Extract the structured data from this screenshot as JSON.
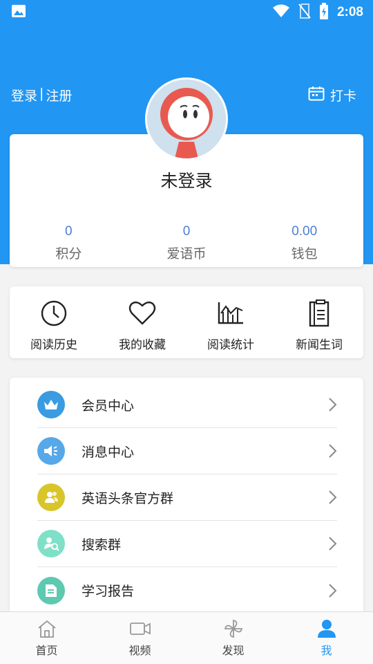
{
  "status_bar": {
    "time": "2:08"
  },
  "header": {
    "login": "登录",
    "separator": "|",
    "register": "注册",
    "checkin": "打卡"
  },
  "profile": {
    "name": "未登录",
    "stats": [
      {
        "value": "0",
        "label": "积分"
      },
      {
        "value": "0",
        "label": "爱语币"
      },
      {
        "value": "0.00",
        "label": "钱包"
      }
    ]
  },
  "quick_actions": [
    {
      "label": "阅读历史",
      "icon": "clock-icon"
    },
    {
      "label": "我的收藏",
      "icon": "heart-icon"
    },
    {
      "label": "阅读统计",
      "icon": "chart-icon"
    },
    {
      "label": "新闻生词",
      "icon": "notebook-icon"
    }
  ],
  "menu": [
    {
      "label": "会员中心",
      "icon": "crown-icon",
      "color": "#3a9be0"
    },
    {
      "label": "消息中心",
      "icon": "speaker-icon",
      "color": "#56a8e8"
    },
    {
      "label": "英语头条官方群",
      "icon": "group-icon",
      "color": "#d8c52a"
    },
    {
      "label": "搜索群",
      "icon": "search-group-icon",
      "color": "#7fe0c8"
    },
    {
      "label": "学习报告",
      "icon": "report-icon",
      "color": "#5dc9b0"
    }
  ],
  "tabs": [
    {
      "label": "首页",
      "icon": "home-icon"
    },
    {
      "label": "视频",
      "icon": "video-icon"
    },
    {
      "label": "发现",
      "icon": "pinwheel-icon"
    },
    {
      "label": "我",
      "icon": "user-icon",
      "active": true
    }
  ],
  "colors": {
    "primary": "#2196f3",
    "stat_value": "#4a7fd4"
  }
}
